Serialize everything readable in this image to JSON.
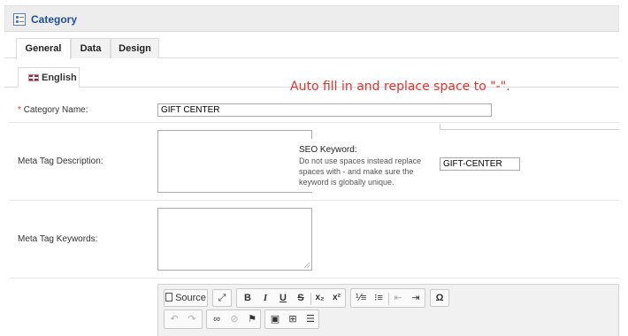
{
  "header": {
    "title": "Category",
    "icon": "category-list-icon"
  },
  "tabs": [
    {
      "label": "General",
      "active": true
    },
    {
      "label": "Data",
      "active": false
    },
    {
      "label": "Design",
      "active": false
    }
  ],
  "language_tab": {
    "label": "English",
    "flag": "uk-flag-icon"
  },
  "annotation": "Auto fill in and replace space to \"-\".",
  "form": {
    "category_name": {
      "required_mark": "*",
      "label": "Category Name:",
      "value": "GIFT CENTER"
    },
    "meta_description": {
      "label": "Meta Tag Description:",
      "value": ""
    },
    "meta_keywords": {
      "label": "Meta Tag Keywords:",
      "value": ""
    }
  },
  "seo": {
    "title": "SEO Keyword:",
    "help": "Do not use spaces instead replace spaces with - and make sure the keyword is globally unique.",
    "value": "GIFT-CENTER"
  },
  "editor_toolbar": {
    "source_label": "Source",
    "bold": "B",
    "italic": "I",
    "underline": "U",
    "strike": "S",
    "subscript": "x₂",
    "superscript": "x²",
    "special_char": "Ω"
  },
  "colors": {
    "accent": "#1f4f96",
    "annotation": "#e3322b",
    "required": "#e3322b"
  }
}
